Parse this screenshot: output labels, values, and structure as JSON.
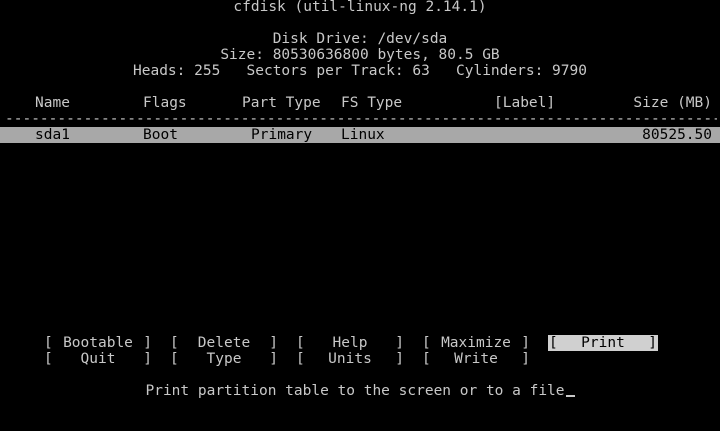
{
  "header": {
    "title": "cfdisk (util-linux-ng 2.14.1)",
    "disk_drive": "Disk Drive: /dev/sda",
    "size": "Size: 80530636800 bytes, 80.5 GB",
    "geometry": "Heads: 255   Sectors per Track: 63   Cylinders: 9790"
  },
  "table": {
    "columns": {
      "name": "Name",
      "flags": "Flags",
      "part_type": "Part Type",
      "fs_type": "FS Type",
      "label": "[Label]",
      "size": "Size (MB)"
    },
    "separator": "------------------------------------------------------------------------------------------------------------------------",
    "rows": [
      {
        "name": "sda1",
        "flags": "Boot",
        "part_type": "Primary",
        "fs_type": "Linux",
        "label": "",
        "size": "80525.50"
      }
    ]
  },
  "menu": {
    "bracket_open": "[",
    "bracket_close": "]",
    "row1": [
      "Bootable",
      "Delete",
      "Help",
      "Maximize",
      "Print"
    ],
    "row2": [
      "Quit",
      "Type",
      "Units",
      "Write"
    ],
    "selected": "Print"
  },
  "status": {
    "message": "Print partition table to the screen or to a file"
  },
  "colors": {
    "foreground": "#c8c8c8",
    "background": "#000000",
    "selection_bar": "#a8a8a8",
    "selected_button": "#d0d0d0"
  }
}
